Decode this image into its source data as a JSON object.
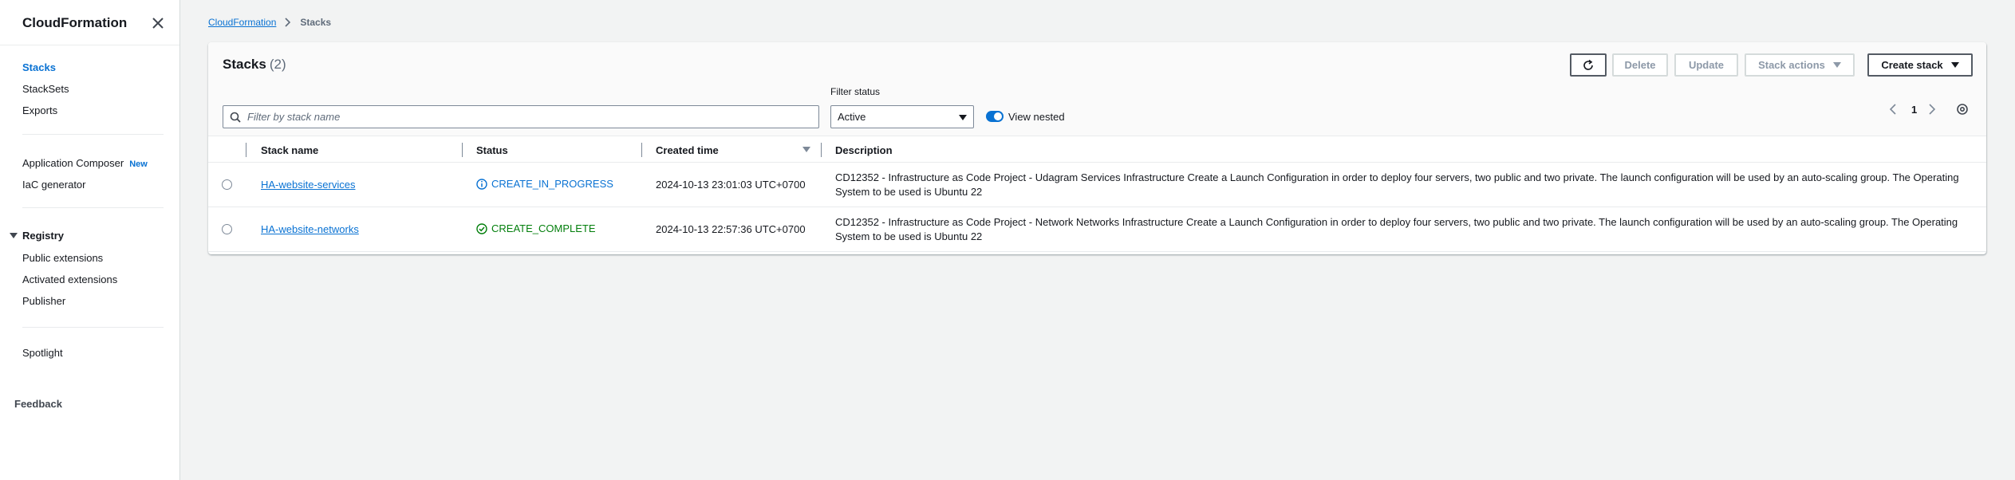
{
  "sidebar": {
    "title": "CloudFormation",
    "nav": [
      {
        "label": "Stacks",
        "active": true
      },
      {
        "label": "StackSets"
      },
      {
        "label": "Exports"
      }
    ],
    "tools": [
      {
        "label": "Application Composer",
        "badge": "New"
      },
      {
        "label": "IaC generator"
      }
    ],
    "registry": {
      "label": "Registry",
      "items": [
        "Public extensions",
        "Activated extensions",
        "Publisher"
      ]
    },
    "spotlight": "Spotlight",
    "feedback": "Feedback"
  },
  "breadcrumb": {
    "root": "CloudFormation",
    "current": "Stacks"
  },
  "panel": {
    "title": "Stacks",
    "count": "(2)",
    "buttons": {
      "delete": "Delete",
      "update": "Update",
      "stack_actions": "Stack actions",
      "create_stack": "Create stack"
    },
    "search_placeholder": "Filter by stack name",
    "filter_label": "Filter status",
    "filter_value": "Active",
    "view_nested": "View nested",
    "page": "1"
  },
  "table": {
    "columns": [
      "Stack name",
      "Status",
      "Created time",
      "Description"
    ],
    "rows": [
      {
        "name": "HA-website-services",
        "status": "CREATE_IN_PROGRESS",
        "status_kind": "info",
        "created": "2024-10-13 23:01:03 UTC+0700",
        "description": "CD12352 - Infrastructure as Code Project - Udagram Services Infrastructure Create a Launch Configuration in order to deploy four servers, two public and two private. The launch configuration will be used by an auto-scaling group. The Operating System to be used is Ubuntu 22"
      },
      {
        "name": "HA-website-networks",
        "status": "CREATE_COMPLETE",
        "status_kind": "success",
        "created": "2024-10-13 22:57:36 UTC+0700",
        "description": "CD12352 - Infrastructure as Code Project - Network Networks Infrastructure Create a Launch Configuration in order to deploy four servers, two public and two private. The launch configuration will be used by an auto-scaling group. The Operating System to be used is Ubuntu 22"
      }
    ]
  },
  "colors": {
    "link": "#0972d3",
    "info": "#0972d3",
    "success": "#037f0c",
    "text": "#16191f",
    "background": "#f2f3f3"
  }
}
